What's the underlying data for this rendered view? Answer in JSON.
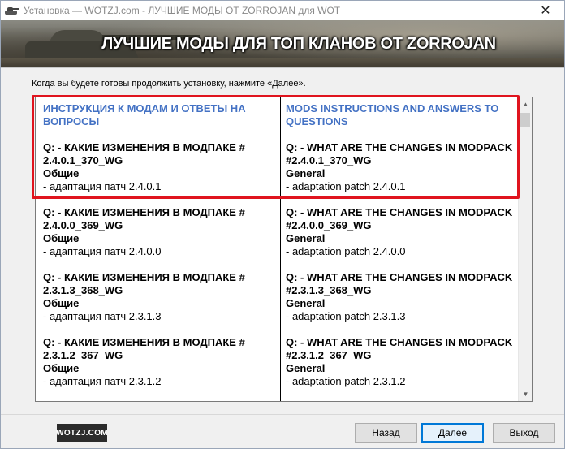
{
  "window": {
    "title": "Установка — WOTZJ.com - ЛУЧШИЕ МОДЫ ОТ ZORROJAN для WOT",
    "close_label": "✕"
  },
  "banner": {
    "title": "ЛУЧШИЕ МОДЫ ДЛЯ ТОП КЛАНОВ ОТ ZORROJAN"
  },
  "instruction": "Когда вы будете готовы продолжить установку, нажмите «Далее».",
  "left": {
    "heading": "ИНСТРУКЦИЯ К МОДАМ И ОТВЕТЫ НА ВОПРОСЫ",
    "entries": [
      {
        "q": "Q: - КАКИЕ ИЗМЕНЕНИЯ В МОДПАКЕ # 2.4.0.1_370_WG",
        "cat": "Общие",
        "note": "- адаптация патч 2.4.0.1"
      },
      {
        "q": "Q: - КАКИЕ ИЗМЕНЕНИЯ В МОДПАКЕ # 2.4.0.0_369_WG",
        "cat": "Общие",
        "note": "- адаптация патч 2.4.0.0"
      },
      {
        "q": "Q: - КАКИЕ ИЗМЕНЕНИЯ В МОДПАКЕ # 2.3.1.3_368_WG",
        "cat": "Общие",
        "note": "- адаптация патч 2.3.1.3"
      },
      {
        "q": "Q: - КАКИЕ ИЗМЕНЕНИЯ В МОДПАКЕ # 2.3.1.2_367_WG",
        "cat": "Общие",
        "note": "- адаптация патч 2.3.1.2"
      }
    ]
  },
  "right": {
    "heading": "MODS INSTRUCTIONS AND ANSWERS TO QUESTIONS",
    "entries": [
      {
        "q": "Q: - WHAT ARE THE CHANGES IN MODPACK #2.4.0.1_370_WG",
        "cat": "General",
        "note": "- adaptation patch 2.4.0.1"
      },
      {
        "q": "Q: - WHAT ARE THE CHANGES IN MODPACK #2.4.0.0_369_WG",
        "cat": "General",
        "note": "- adaptation patch 2.4.0.0"
      },
      {
        "q": "Q: - WHAT ARE THE CHANGES IN MODPACK #2.3.1.3_368_WG",
        "cat": "General",
        "note": "- adaptation patch 2.3.1.3"
      },
      {
        "q": "Q: - WHAT ARE THE CHANGES IN MODPACK #2.3.1.2_367_WG",
        "cat": "General",
        "note": "- adaptation patch 2.3.1.2"
      }
    ]
  },
  "footer": {
    "logo": "WOTZJ.COM",
    "back_label": "Назад",
    "next_label": "Далее",
    "exit_label": "Выход"
  },
  "colors": {
    "heading": "#4472c4",
    "highlight": "#e0141e",
    "focus": "#0078d7"
  },
  "icons": {
    "app": "tank-icon",
    "close": "close-icon",
    "scroll_up": "chevron-up-icon",
    "scroll_down": "chevron-down-icon"
  }
}
